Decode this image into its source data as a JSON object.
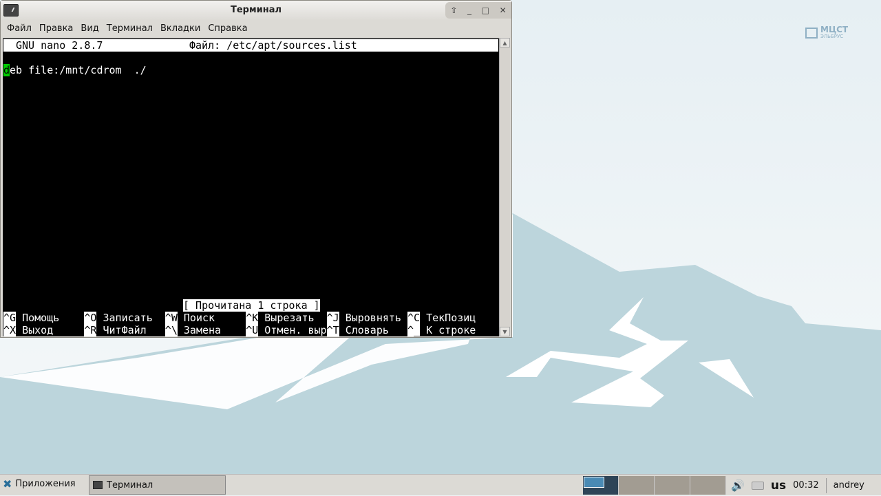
{
  "window": {
    "title": "Терминал",
    "buttons": [
      "⇧",
      "_",
      "□",
      "✕"
    ]
  },
  "menu": [
    "Файл",
    "Правка",
    "Вид",
    "Терминал",
    "Вкладки",
    "Справка"
  ],
  "nano": {
    "header_left": "GNU nano 2.8.7",
    "header_file": "Файл: /etc/apt/sources.list",
    "line1_cursor": "d",
    "line1_rest": "eb file:/mnt/cdrom  ./",
    "status": "[ Прочитана 1 строка ]",
    "shortcuts_row1": [
      {
        "key": "^G",
        "label": "Помощь"
      },
      {
        "key": "^O",
        "label": "Записать"
      },
      {
        "key": "^W",
        "label": "Поиск"
      },
      {
        "key": "^K",
        "label": "Вырезать"
      },
      {
        "key": "^J",
        "label": "Выровнять"
      },
      {
        "key": "^C",
        "label": "ТекПозиц"
      }
    ],
    "shortcuts_row2": [
      {
        "key": "^X",
        "label": "Выход"
      },
      {
        "key": "^R",
        "label": "ЧитФайл"
      },
      {
        "key": "^\\",
        "label": "Замена"
      },
      {
        "key": "^U",
        "label": "Отмен. выр"
      },
      {
        "key": "^T",
        "label": "Словарь"
      },
      {
        "key": "^_",
        "label": "К строке"
      }
    ]
  },
  "logo": {
    "line1": "МЦСТ",
    "line2": "ЭЛЬБРУС"
  },
  "taskbar": {
    "apps_label": "Приложения",
    "task_label": "Терминал",
    "keyboard": "us",
    "clock": "00:32",
    "user": "andrey",
    "workspaces": 4,
    "active_workspace": 1
  },
  "colors": {
    "cursor": "#00c000",
    "mountain": "#bcd5dc",
    "taskbar": "#dcdad5"
  }
}
